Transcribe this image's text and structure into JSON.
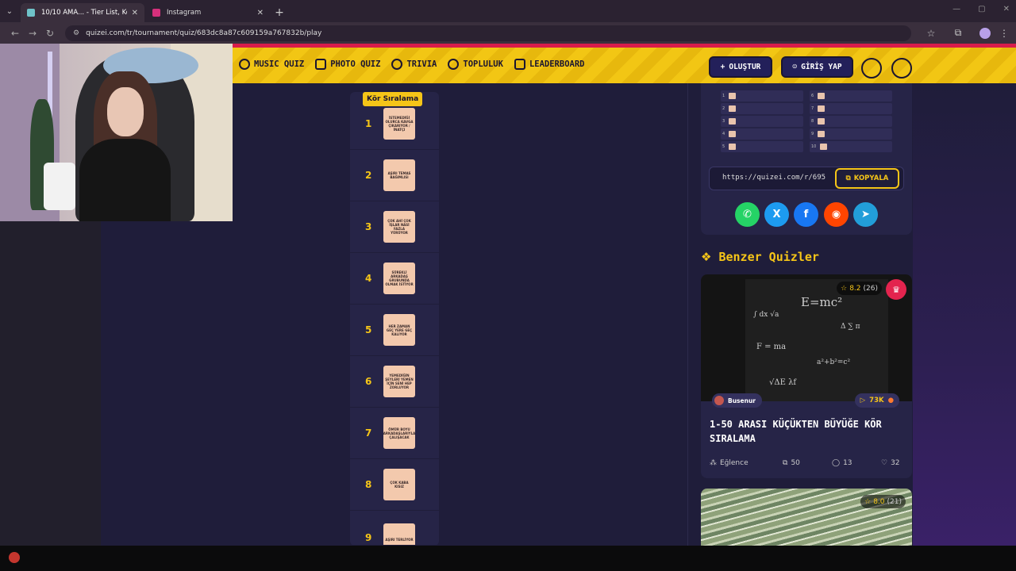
{
  "browser": {
    "tabs": [
      {
        "title": "10/10 AMA... - Tier List, Kör Sıra",
        "active": true,
        "favicon_color": "#6fc3c9"
      },
      {
        "title": "Instagram",
        "active": false,
        "favicon_color": "#d6307c"
      }
    ],
    "new_tab": "+",
    "url": "quizei.com/tr/tournament/quiz/683dc8a87c609159a767832b/play"
  },
  "header": {
    "nav": [
      {
        "label": "MUSIC QUIZ",
        "icon": "music-note-icon"
      },
      {
        "label": "PHOTO QUIZ",
        "icon": "camera-icon"
      },
      {
        "label": "TRIVIA",
        "icon": "speech-bubble-icon"
      },
      {
        "label": "TOPLULUK",
        "icon": "users-icon"
      },
      {
        "label": "LEADERBOARD",
        "icon": "trophy-icon"
      }
    ],
    "create_label": "OLUŞTUR",
    "create_icon": "+",
    "login_label": "GİRİŞ YAP",
    "login_icon": "user-icon"
  },
  "ranking": {
    "badge": "Kör Sıralama",
    "rows": [
      {
        "rank": "1",
        "card_text": "İSTEMEDİĞİ OLURCA KAVGA ÇIKARIYOR / İNATÇI"
      },
      {
        "rank": "2",
        "card_text": "AŞIRI TEMAS BAĞIMLISI"
      },
      {
        "rank": "3",
        "card_text": "ÇOK AHİ ÇOK İŞLAR NASİ FAZLA YÜRÜYOR"
      },
      {
        "rank": "4",
        "card_text": "SÜREKLİ ARKADAŞ GRUBUNDA OLMAK İSTİYOR"
      },
      {
        "rank": "5",
        "card_text": "HER ZAMAN GEÇ YERE GEÇ KALIYOR"
      },
      {
        "rank": "6",
        "card_text": "YEMEDİĞİN ŞEYLERİ YEMEN İÇİN SENİ HEP ZORLUYOR"
      },
      {
        "rank": "7",
        "card_text": "ÖMÜR BOYU ARKADAŞLARIYLA ÇALIŞACAK"
      },
      {
        "rank": "8",
        "card_text": "ÇOK KABA KISIZ"
      },
      {
        "rank": "9",
        "card_text": "AŞIRI TERLİYOR"
      }
    ]
  },
  "share": {
    "mini_list_left": [
      "1",
      "2",
      "3",
      "4",
      "5"
    ],
    "mini_list_right": [
      "6",
      "7",
      "8",
      "9",
      "10"
    ],
    "link": "https://quizei.com/r/695",
    "copy_label": "KOPYALA",
    "socials": [
      {
        "name": "whatsapp",
        "glyph": "✆",
        "color": "#25d366"
      },
      {
        "name": "x",
        "glyph": "X",
        "color": "#1d9bf0"
      },
      {
        "name": "facebook",
        "glyph": "f",
        "color": "#1877f2"
      },
      {
        "name": "reddit",
        "glyph": "◉",
        "color": "#ff4500"
      },
      {
        "name": "telegram",
        "glyph": "➤",
        "color": "#229ed9"
      }
    ]
  },
  "similar": {
    "title": "Benzer Quizler",
    "card1": {
      "rating": "8.2",
      "rating_count": "(26)",
      "author": "Busenur",
      "plays": "73K",
      "title": "1-50 ARASI KÜÇÜKTEN BÜYÜĞE KÖR SIRALAMA",
      "category": "Eğlence",
      "questions": "50",
      "comments": "13",
      "likes": "32"
    },
    "card2": {
      "rating": "8.0",
      "rating_count": "(21)"
    }
  },
  "colors": {
    "accent_yellow": "#f5c518",
    "header_red": "#d81c4b",
    "button_navy": "#23205a"
  }
}
